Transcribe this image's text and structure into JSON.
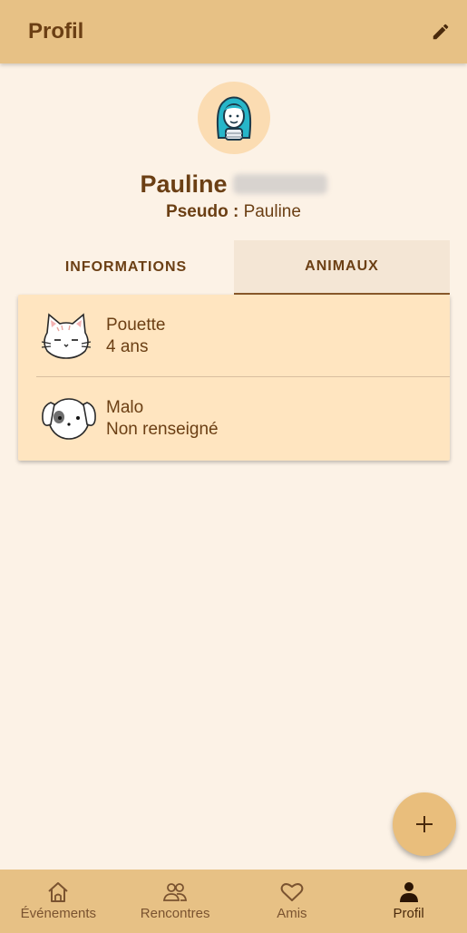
{
  "app_bar": {
    "title": "Profil",
    "edit_icon": "pencil-icon"
  },
  "profile": {
    "first_name": "Pauline",
    "pseudo_label": "Pseudo :",
    "pseudo_value": "Pauline"
  },
  "tabs": [
    {
      "label": "INFORMATIONS",
      "active": false
    },
    {
      "label": "ANIMAUX",
      "active": true
    }
  ],
  "animals": [
    {
      "name": "Pouette",
      "detail": "4 ans",
      "icon": "cat-icon"
    },
    {
      "name": "Malo",
      "detail": "Non renseigné",
      "icon": "dog-icon"
    }
  ],
  "fab": {
    "icon": "plus-icon"
  },
  "bottom_nav": [
    {
      "label": "Événements",
      "icon": "home-icon",
      "active": false
    },
    {
      "label": "Rencontres",
      "icon": "people-icon",
      "active": false
    },
    {
      "label": "Amis",
      "icon": "heart-icon",
      "active": false
    },
    {
      "label": "Profil",
      "icon": "person-icon",
      "active": true
    }
  ],
  "colors": {
    "background": "#fcf2e6",
    "app_bar": "#e7c185",
    "card": "#ffe5c0",
    "text": "#6b3f14"
  }
}
